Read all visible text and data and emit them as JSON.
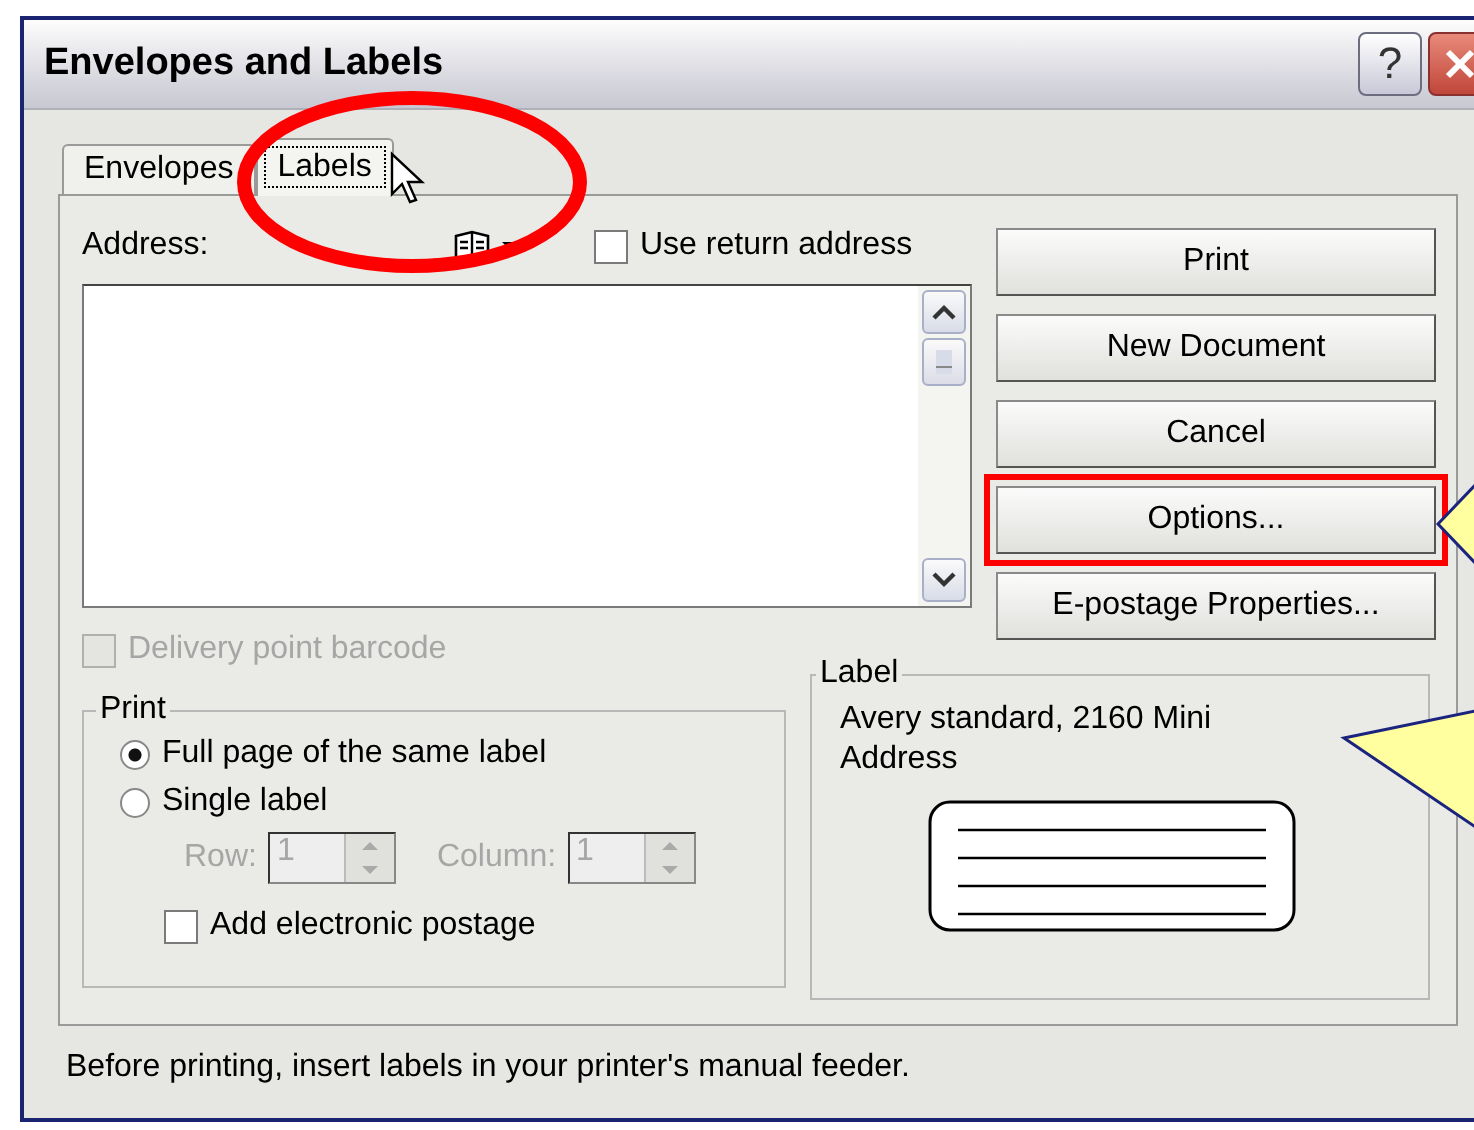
{
  "window": {
    "title": "Envelopes and Labels",
    "help": "?"
  },
  "tabs": [
    {
      "label": "Envelopes",
      "selected": false
    },
    {
      "label": "Labels",
      "selected": true
    }
  ],
  "address": {
    "label": "Address:"
  },
  "use_return_address": {
    "label": "Use return address",
    "checked": false
  },
  "delivery_point_barcode": {
    "label": "Delivery point barcode",
    "checked": false,
    "disabled": true
  },
  "buttons": [
    {
      "label": "Print",
      "highlighted": false
    },
    {
      "label": "New Document",
      "highlighted": false
    },
    {
      "label": "Cancel",
      "highlighted": false
    },
    {
      "label": "Options...",
      "highlighted": true
    },
    {
      "label": "E-postage Properties...",
      "highlighted": false
    }
  ],
  "print_group": {
    "title": "Print",
    "options": [
      {
        "label": "Full page of the same label",
        "selected": true
      },
      {
        "label": "Single label",
        "selected": false
      }
    ],
    "spinners": [
      {
        "label": "Row:",
        "value": "1",
        "disabled": true
      },
      {
        "label": "Column:",
        "value": "1",
        "disabled": true
      }
    ],
    "add_electronic_postage": {
      "label": "Add electronic postage",
      "checked": false
    }
  },
  "label_group": {
    "title": "Label",
    "description": "Avery standard, 2160 Mini Address"
  },
  "footer": "Before printing, insert labels in your printer's manual feeder."
}
